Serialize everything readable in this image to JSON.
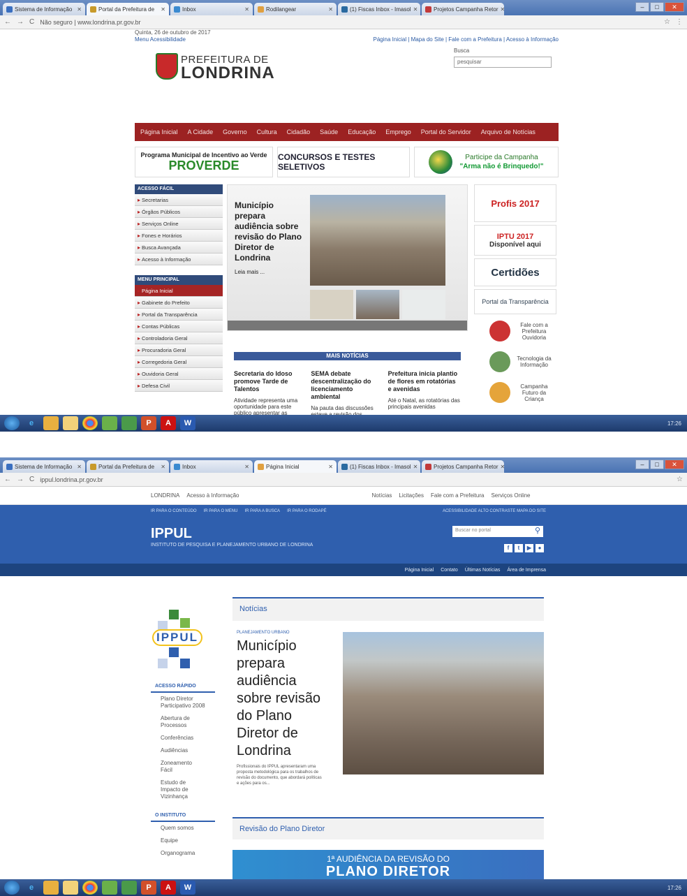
{
  "shot1": {
    "tabs": [
      {
        "label": "Sistema de Informação",
        "color": "#3a6fc0"
      },
      {
        "label": "Portal da Prefeitura de",
        "color": "#c89a2a",
        "active": true
      },
      {
        "label": "Inbox",
        "color": "#3a8ad0"
      },
      {
        "label": "Rodilangear",
        "color": "#e0a040"
      },
      {
        "label": "(1) Fiscas Inbox - Imasol",
        "color": "#2a6aa0"
      },
      {
        "label": "Projetos Campanha Retor",
        "color": "#c23a3a"
      }
    ],
    "url": "Não seguro | www.londrina.pr.gov.br",
    "site": {
      "date": "Quinta, 26 de outubro de 2017",
      "accessibility": "Menu Acessibilidade",
      "toplinks": "Página Inicial | Mapa do Site | Fale com a Prefeitura | Acesso à Informação",
      "logo_line1": "PREFEITURA DE",
      "logo_line2": "LONDRINA",
      "search_label": "Busca",
      "search_placeholder": "pesquisar",
      "menu": [
        "Página Inicial",
        "A Cidade",
        "Governo",
        "Cultura",
        "Cidadão",
        "Saúde",
        "Educação",
        "Emprego",
        "Portal do Servidor",
        "Arquivo de Notícias"
      ],
      "banner1_small": "Programa Municipal de Incentivo ao Verde",
      "banner1_big": "PROVERDE",
      "banner2": "CONCURSOS E TESTES SELETIVOS",
      "banner3_line1": "Participe da Campanha",
      "banner3_line2": "\"Arma não é Brinquedo!\"",
      "acesso_header": "ACESSO FÁCIL",
      "acesso_items": [
        "Secretarias",
        "Órgãos Públicos",
        "Serviços Online",
        "Fones e Horários",
        "Busca Avançada",
        "Acesso à Informação"
      ],
      "menu_header": "MENU PRINCIPAL",
      "menu_items": [
        "Página Inicial",
        "Gabinete do Prefeito",
        "Portal da Transparência",
        "Contas Públicas",
        "Controladoria Geral",
        "Procuradoria Geral",
        "Corregedoria Geral",
        "Ouvidoria Geral",
        "Defesa Civil"
      ],
      "feature_title": "Município prepara audiência sobre revisão do Plano Diretor de Londrina",
      "feature_more": "Leia mais ...",
      "mais_noticias": "MAIS NOTÍCIAS",
      "news": [
        {
          "title": "Secretaria do Idoso promove Tarde de Talentos",
          "text": "Atividade representa uma oportunidade para este público apresentar as"
        },
        {
          "title": "SEMA debate descentralização do licenciamento ambiental",
          "text": "Na pauta das discussões esteve a revisão dos"
        },
        {
          "title": "Prefeitura inicia plantio de flores em rotatórias e avenidas",
          "text": "Até o Natal, as rotatórias das principais avenidas"
        }
      ],
      "right": {
        "profis": "Profis 2017",
        "iptu_line1": "IPTU 2017",
        "iptu_line2": "Disponível aqui",
        "certidoes": "Certidões",
        "transparencia": "Portal da Transparência",
        "ouvidoria": "Fale com a Prefeitura Ouvidoria",
        "tecnologia": "Tecnologia da Informação",
        "campanha": "Campanha Futuro da Criança"
      }
    }
  },
  "shot2": {
    "tabs": [
      {
        "label": "Sistema de Informação",
        "color": "#3a6fc0"
      },
      {
        "label": "Portal da Prefeitura de",
        "color": "#c89a2a"
      },
      {
        "label": "Inbox",
        "color": "#3a8ad0"
      },
      {
        "label": "Página Inicial",
        "color": "#e0a040",
        "active": true
      },
      {
        "label": "(1) Fiscas Inbox - Imasol",
        "color": "#2a6aa0"
      },
      {
        "label": "Projetos Campanha Retor",
        "color": "#c23a3a"
      }
    ],
    "url": "ippul.londrina.pr.gov.br",
    "site": {
      "top_left": "LONDRINA",
      "top_access": "Acesso à Informação",
      "top_links": [
        "Notícias",
        "Licitações",
        "Fale com a Prefeitura",
        "Serviços Online"
      ],
      "inst_links": [
        "IR PARA O CONTEÚDO",
        "IR PARA O MENU",
        "IR PARA A BUSCA",
        "IR PARA O RODAPÉ"
      ],
      "access_links": "ACESSIBILIDADE   ALTO CONTRASTE   MAPA DO SITE",
      "title": "IPPUL",
      "subtitle": "INSTITUTO DE PESQUISA E PLANEJAMENTO URBANO DE LONDRINA",
      "search_placeholder": "Buscar no portal",
      "nav": [
        "Página Inicial",
        "Contato",
        "Últimas Notícias",
        "Área de Imprensa"
      ],
      "logo_word": "IPPUL",
      "acesso_header": "ACESSO RÁPIDO",
      "acesso_items": [
        "Plano Diretor Participativo 2008",
        "Abertura de Processos",
        "Conferências",
        "Audiências",
        "Zoneamento Fácil",
        "Estudo de Impacto de Vizinhança"
      ],
      "instituto_header": "O INSTITUTO",
      "instituto_items": [
        "Quem somos",
        "Equipe",
        "Organograma"
      ],
      "news_header": "Notícias",
      "news_category": "PLANEJAMENTO URBANO",
      "news_title": "Município prepara audiência sobre revisão do Plano Diretor de Londrina",
      "news_lead": "Profissionais do IPPUL apresentaram uma proposta metodológica para os trabalhos de revisão do documento, que abordará políticas e ações para os...",
      "section2": "Revisão do Plano Diretor",
      "banner_line1": "1ª AUDIÊNCIA DA REVISÃO DO",
      "banner_line2": "PLANO DIRETOR"
    }
  },
  "taskbar": {
    "icons": [
      "start",
      "ie",
      "folder",
      "explorer",
      "chrome",
      "app",
      "calc",
      "ppt",
      "pdf",
      "word"
    ],
    "time": "17:26"
  }
}
